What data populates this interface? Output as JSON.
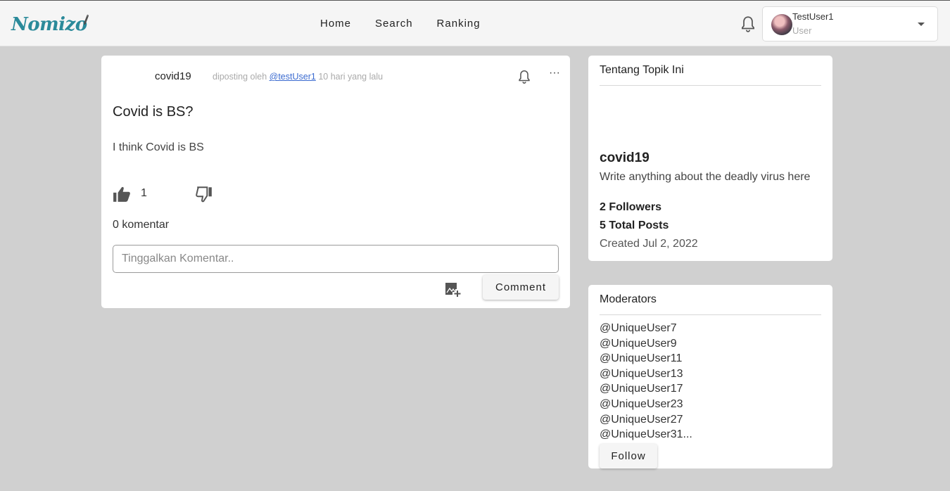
{
  "brand": {
    "logo_text": "Nomizo",
    "accent_color": "#2b8a9a"
  },
  "nav": {
    "links": [
      {
        "label": "Home"
      },
      {
        "label": "Search"
      },
      {
        "label": "Ranking"
      }
    ]
  },
  "user": {
    "name": "TestUser1",
    "role": "User"
  },
  "post": {
    "topic": "covid19",
    "meta_prefix": "diposting oleh",
    "author_handle": "@testUser1",
    "time_ago": "10 hari yang lalu",
    "title": "Covid is BS?",
    "body": "I think Covid is BS",
    "like_count": "1",
    "comment_count_label": "0 komentar",
    "comment_placeholder": "Tinggalkan Komentar..",
    "comment_button": "Comment",
    "more_label": "···"
  },
  "about": {
    "header": "Tentang Topik Ini",
    "name": "covid19",
    "description": "Write anything about the deadly virus here",
    "followers": "2 Followers",
    "total_posts": "5 Total Posts",
    "created": "Created Jul 2, 2022"
  },
  "moderators": {
    "header": "Moderators",
    "list": [
      "@UniqueUser7",
      "@UniqueUser9",
      "@UniqueUser11",
      "@UniqueUser13",
      "@UniqueUser17",
      "@UniqueUser23",
      "@UniqueUser27",
      "@UniqueUser31..."
    ],
    "follow_button": "Follow"
  },
  "icons": {
    "top_bell": "bell-icon",
    "post_bell": "bell-icon",
    "like": "thumb-up-icon",
    "dislike": "thumb-down-icon",
    "image_add": "image-add-icon",
    "dropdown": "chevron-down-icon"
  }
}
